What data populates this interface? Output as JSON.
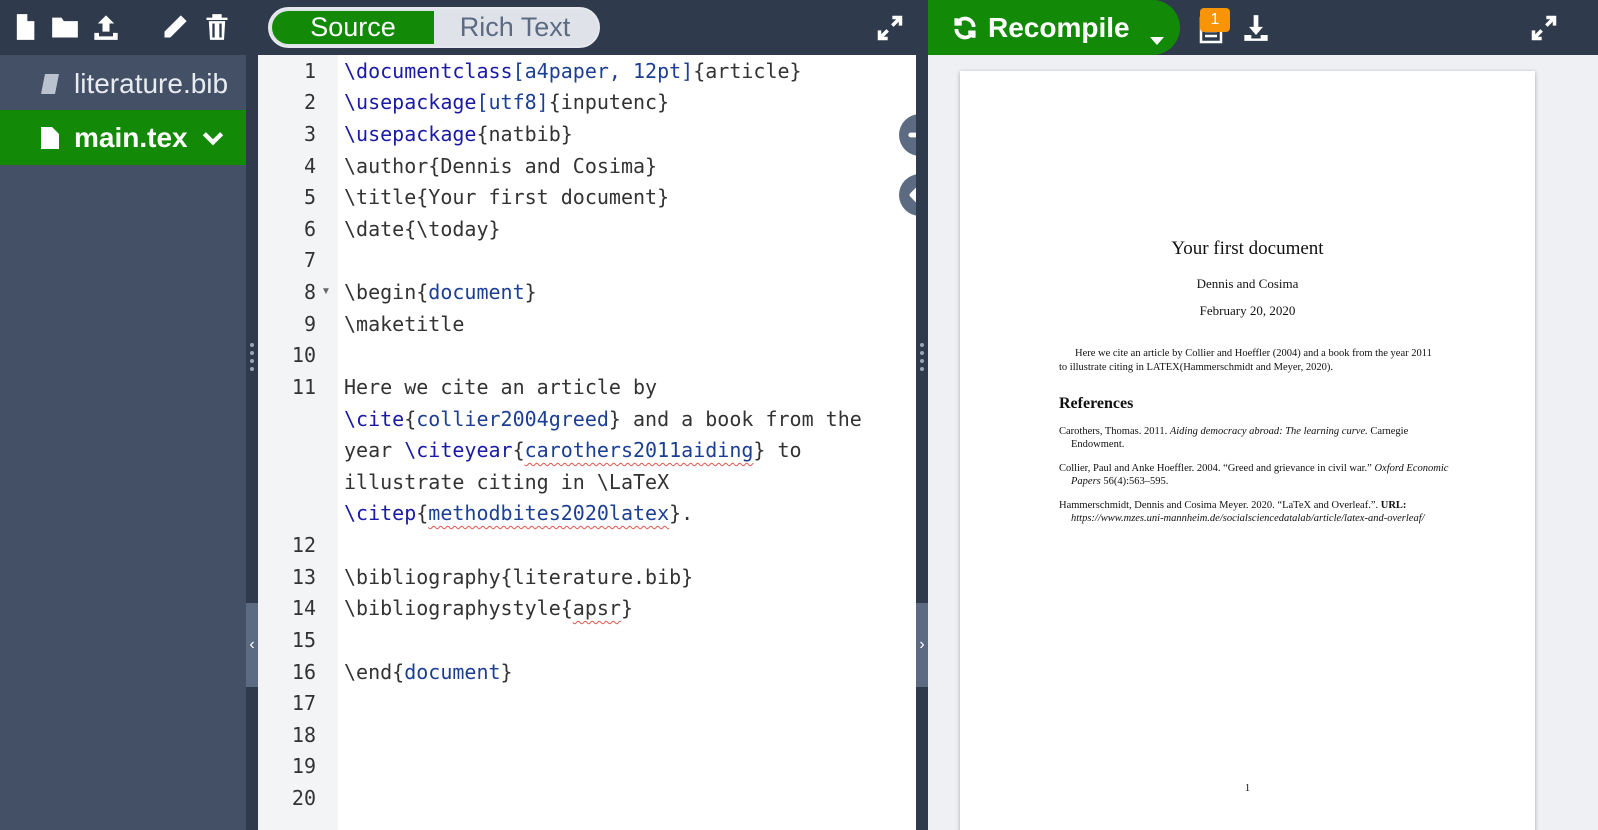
{
  "sidebar": {
    "files": [
      {
        "name": "literature.bib",
        "icon": "book-icon"
      },
      {
        "name": "main.tex",
        "icon": "file-icon"
      }
    ]
  },
  "editor": {
    "modes": {
      "source": "Source",
      "rich": "Rich Text"
    },
    "line_numbers": [
      "1",
      "2",
      "3",
      "4",
      "5",
      "6",
      "7",
      "8",
      "9",
      "10",
      "11",
      "12",
      "13",
      "14",
      "15",
      "16",
      "17",
      "18",
      "19",
      "20"
    ]
  },
  "pdf_toolbar": {
    "recompile_label": "Recompile",
    "logs_badge": "1"
  },
  "pdf": {
    "title": "Your first document",
    "author": "Dennis and Cosima",
    "date": "February 20, 2020",
    "abstract": "Here we cite an article by Collier and Hoeffler (2004) and a book from the year 2011 to illustrate citing in LATEX(Hammerschmidt and Meyer, 2020).",
    "references_heading": "References",
    "ref1_a": "Carothers, Thomas. 2011.",
    "ref1_b": "Aiding democracy abroad: The learning curve.",
    "ref1_c": "Carnegie Endowment.",
    "ref2_a": "Collier, Paul and Anke Hoeffler. 2004. “Greed and grievance in civil war.”",
    "ref2_b": "Oxford Economic Papers",
    "ref2_c": "56(4):563–595.",
    "ref3_a": "Hammerschmidt, Dennis and Cosima Meyer. 2020. “LaTeX and Overleaf.”.",
    "ref3_b": "URL:",
    "ref3_c": "https://www.mzes.uni-mannheim.de/socialsciencedatalab/article/latex-and-overleaf/",
    "page_number": "1"
  },
  "colors": {
    "accent_green": "#138a07",
    "dark_toolbar": "#2f3a4c",
    "sidebar_bg": "#435066",
    "badge_orange": "#f89406"
  }
}
